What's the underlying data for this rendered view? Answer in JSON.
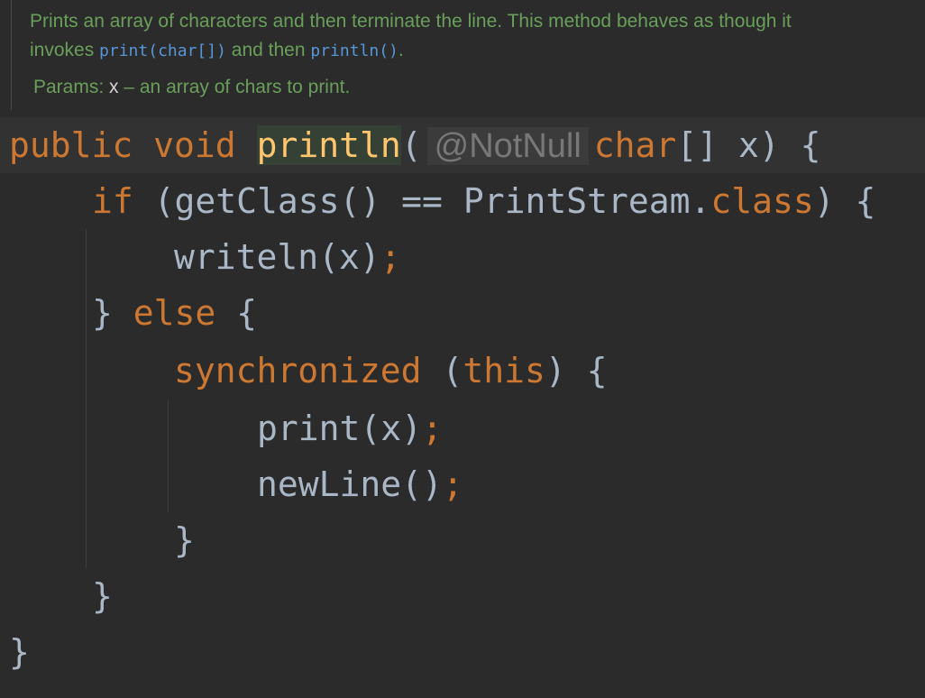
{
  "doc": {
    "line1_pre": "Prints an array of characters and then terminate the line. This method behaves as though it",
    "line2_a": "invokes ",
    "line2_code1": "print(char[])",
    "line2_b": " and then ",
    "line2_code2": "println()",
    "line2_c": ".",
    "params_label": "Params: ",
    "params_name": "x",
    "params_desc": " – an array of chars to print."
  },
  "code": {
    "l1_kw1": "public",
    "l1_kw2": "void",
    "l1_name": "println",
    "l1_paren": "(",
    "l1_anno": "@NotNull",
    "l1_type": "char",
    "l1_rest": "[] x) {",
    "l2_if": "if",
    "l2_rest1": " (getClass() == PrintStream.",
    "l2_class": "class",
    "l2_rest2": ") {",
    "l3_call": "writeln(x)",
    "l3_semi": ";",
    "l4_brace": "} ",
    "l4_else": "else",
    "l4_rest": " {",
    "l5_sync": "synchronized",
    "l5_paren1": " (",
    "l5_this": "this",
    "l5_rest": ") {",
    "l6_call": "print(x)",
    "l6_semi": ";",
    "l7_call": "newLine()",
    "l7_semi": ";",
    "l8_brace": "}",
    "l9_brace": "}",
    "l10_brace": "}"
  }
}
